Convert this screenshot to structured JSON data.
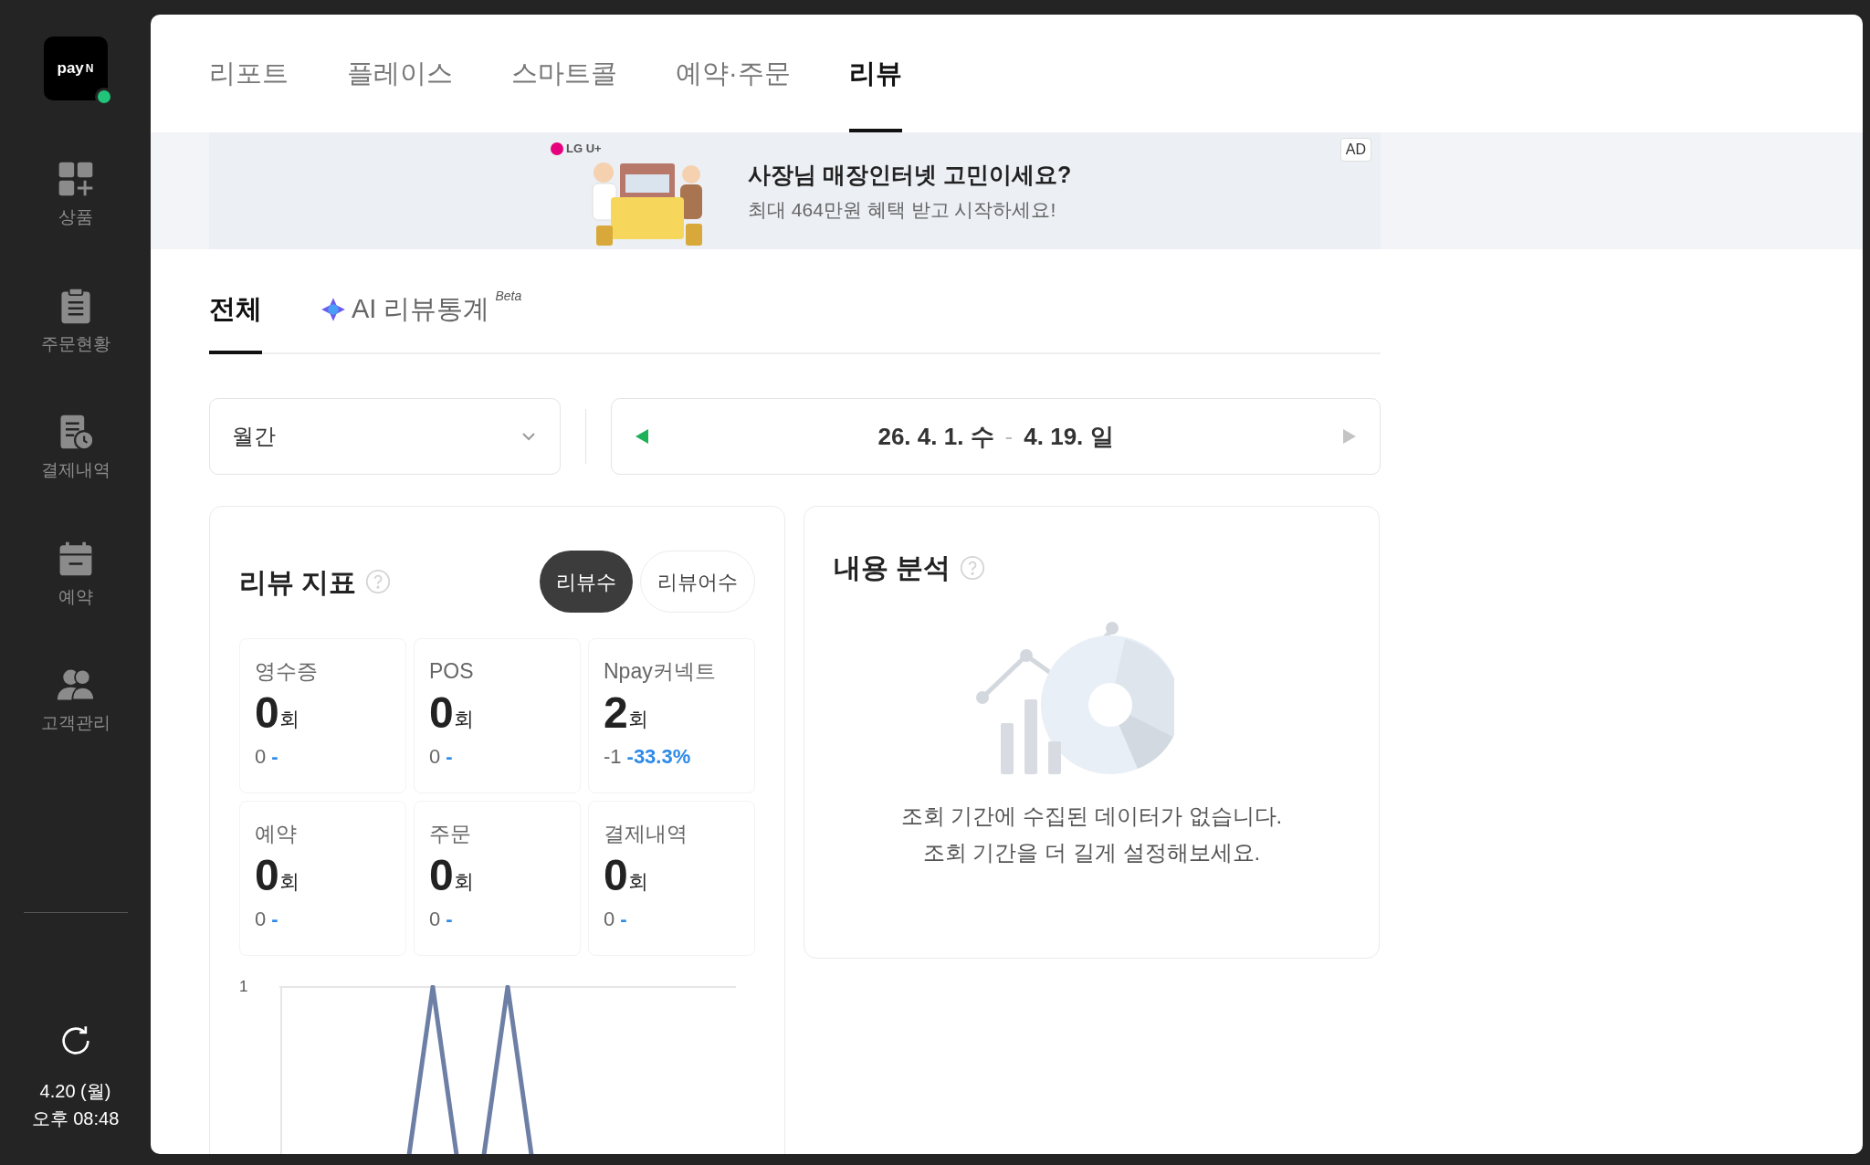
{
  "sidebar": {
    "logo": {
      "text": "pay",
      "mark": "N",
      "online": true
    },
    "items": [
      {
        "label": "상품"
      },
      {
        "label": "주문현황"
      },
      {
        "label": "결제내역"
      },
      {
        "label": "예약"
      },
      {
        "label": "고객관리"
      }
    ],
    "date": "4.20 (월)",
    "time": "오후 08:48"
  },
  "top_tabs": [
    {
      "label": "리포트",
      "selected": false
    },
    {
      "label": "플레이스",
      "selected": false
    },
    {
      "label": "스마트콜",
      "selected": false
    },
    {
      "label": "예약·주문",
      "selected": false
    },
    {
      "label": "리뷰",
      "selected": true
    }
  ],
  "ad": {
    "brand": "LG U+",
    "headline": "사장님 매장인터넷 고민이세요?",
    "subline": "최대 464만원 혜택 받고 시작하세요!",
    "badge": "AD"
  },
  "sub_tabs": [
    {
      "label": "전체",
      "selected": true
    },
    {
      "label": "AI 리뷰통계",
      "badge": "Beta",
      "selected": false
    }
  ],
  "period_select": {
    "value": "월간"
  },
  "date_range": {
    "start": "26. 4. 1. 수",
    "separator": "-",
    "end": "4. 19. 일"
  },
  "review_metrics": {
    "title": "리뷰 지표",
    "toggles": [
      {
        "label": "리뷰수",
        "selected": true
      },
      {
        "label": "리뷰어수",
        "selected": false
      }
    ],
    "cards": [
      {
        "label": "영수증",
        "value": "0",
        "unit": "회",
        "change": "0",
        "rate": "-"
      },
      {
        "label": "POS",
        "value": "0",
        "unit": "회",
        "change": "0",
        "rate": "-"
      },
      {
        "label": "Npay커넥트",
        "value": "2",
        "unit": "회",
        "change": "-1",
        "rate": "-33.3%"
      },
      {
        "label": "예약",
        "value": "0",
        "unit": "회",
        "change": "0",
        "rate": "-"
      },
      {
        "label": "주문",
        "value": "0",
        "unit": "회",
        "change": "0",
        "rate": "-"
      },
      {
        "label": "결제내역",
        "value": "0",
        "unit": "회",
        "change": "0",
        "rate": "-"
      }
    ],
    "chart": {
      "ytick": "1"
    }
  },
  "content_analysis": {
    "title": "내용 분석",
    "empty_lines": [
      "조회 기간에 수집된 데이터가 없습니다.",
      "조회 기간을 더 길게 설정해보세요."
    ]
  }
}
